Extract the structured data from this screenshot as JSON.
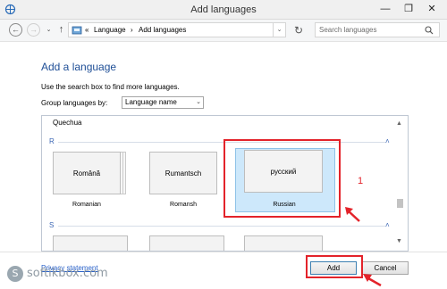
{
  "window": {
    "title": "Add languages",
    "min": "—",
    "max": "❐",
    "close": "✕"
  },
  "nav": {
    "back": "←",
    "forward": "→",
    "dropdown": "⌄",
    "up": "↑",
    "refresh": "↻"
  },
  "address": {
    "crumb_sep_root": "«",
    "crumbs": [
      "Language",
      "Add languages"
    ],
    "sep": "›",
    "dropdown": "⌄"
  },
  "search": {
    "placeholder": "Search languages",
    "icon": "search-icon"
  },
  "page": {
    "heading": "Add a language",
    "hint": "Use the search box to find more languages.",
    "group_label": "Group languages by:",
    "group_value": "Language name",
    "group_dropdown": "⌄"
  },
  "list": {
    "top_item": "Quechua",
    "sections": [
      {
        "letter": "R",
        "collapse": "˄",
        "tiles": [
          {
            "native": "Română",
            "english": "Romanian",
            "selected": false
          },
          {
            "native": "Rumantsch",
            "english": "Romansh",
            "selected": false
          },
          {
            "native": "русский",
            "english": "Russian",
            "selected": true
          }
        ]
      },
      {
        "letter": "S",
        "collapse": "˄"
      }
    ],
    "scroll_up": "▲",
    "scroll_down": "▼"
  },
  "footer": {
    "privacy": "Privacy statement",
    "add": "Add",
    "cancel": "Cancel"
  },
  "annotation": {
    "number": "1",
    "color": "#e3232a"
  },
  "watermark": {
    "text": "softikbox.com",
    "glyph": "S"
  },
  "colors": {
    "heading": "#1e4e96",
    "link": "#2a62c9",
    "selection": "#cde8fb",
    "accent_red": "#e3232a"
  }
}
